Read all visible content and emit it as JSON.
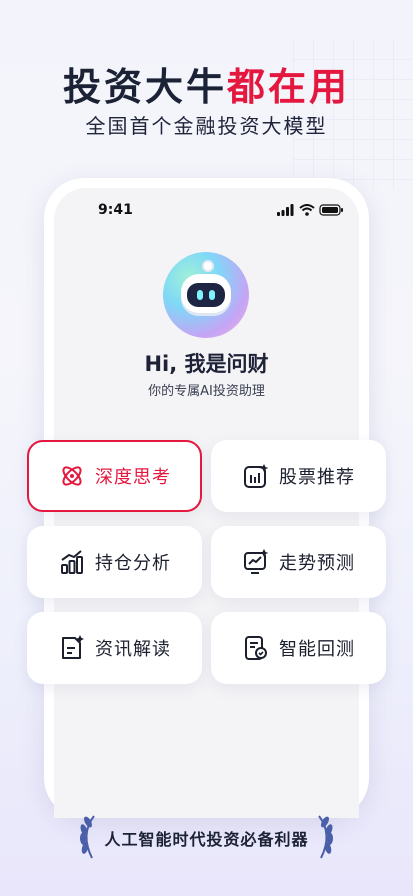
{
  "hero": {
    "title_main": "投资大牛",
    "title_accent": "都在用",
    "subtitle": "全国首个金融投资大模型"
  },
  "status_bar": {
    "time": "9:41",
    "icons": [
      "signal-icon",
      "wifi-icon",
      "battery-icon"
    ]
  },
  "assistant": {
    "avatar_icon": "robot-icon",
    "greeting": "Hi, 我是问财",
    "description": "你的专属AI投资助理"
  },
  "features": [
    {
      "label": "深度思考",
      "icon": "atom-icon",
      "selected": true
    },
    {
      "label": "股票推荐",
      "icon": "stock-recommend-icon",
      "selected": false
    },
    {
      "label": "持仓分析",
      "icon": "holdings-chart-icon",
      "selected": false
    },
    {
      "label": "走势预测",
      "icon": "trend-forecast-icon",
      "selected": false
    },
    {
      "label": "资讯解读",
      "icon": "news-doc-icon",
      "selected": false
    },
    {
      "label": "智能回测",
      "icon": "backtest-icon",
      "selected": false
    }
  ],
  "footer": {
    "slogan": "人工智能时代投资必备利器"
  },
  "colors": {
    "accent": "#e4173f",
    "text_dark": "#1c2236",
    "card_bg": "#ffffff"
  }
}
